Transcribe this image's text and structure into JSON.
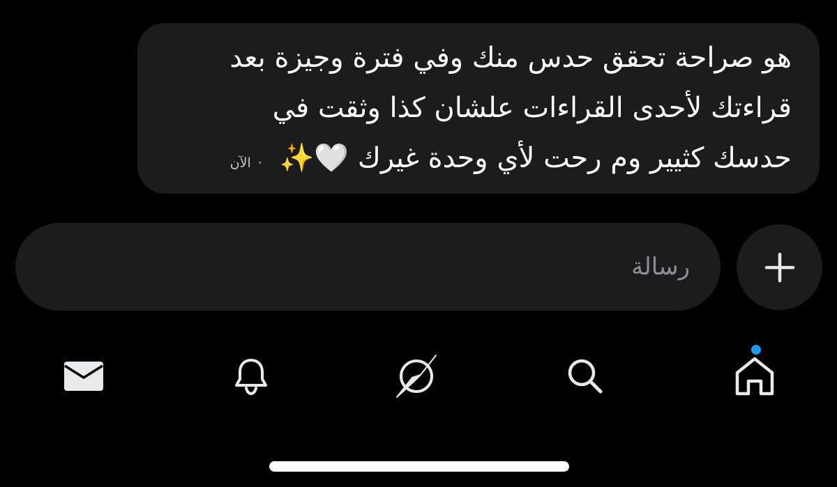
{
  "message": {
    "line1": "هو صراحة تحقق حدس منك وفي فترة وجيزة بعد",
    "line2": "قراءتك لأحدى القراءات علشان كذا وثقت في",
    "line3": "حدسك كثيير وم رحت لأي وحدة غيرك 🤍✨",
    "dot": "·",
    "timestamp": "الآن"
  },
  "composer": {
    "placeholder": "رسالة"
  },
  "plus_button": {
    "icon": "plus-icon"
  },
  "tabbar": {
    "items": [
      {
        "icon": "mail-icon",
        "active": false
      },
      {
        "icon": "bell-icon",
        "active": false
      },
      {
        "icon": "compass-icon",
        "active": false
      },
      {
        "icon": "search-icon",
        "active": false
      },
      {
        "icon": "home-icon",
        "active": true,
        "badge": true
      }
    ]
  },
  "colors": {
    "background": "#000000",
    "surface": "#1c1c1e",
    "text": "#ffffff",
    "placeholder": "#8e8e93",
    "badge": "#1d9bf0",
    "icon": "#e7e9ea"
  }
}
